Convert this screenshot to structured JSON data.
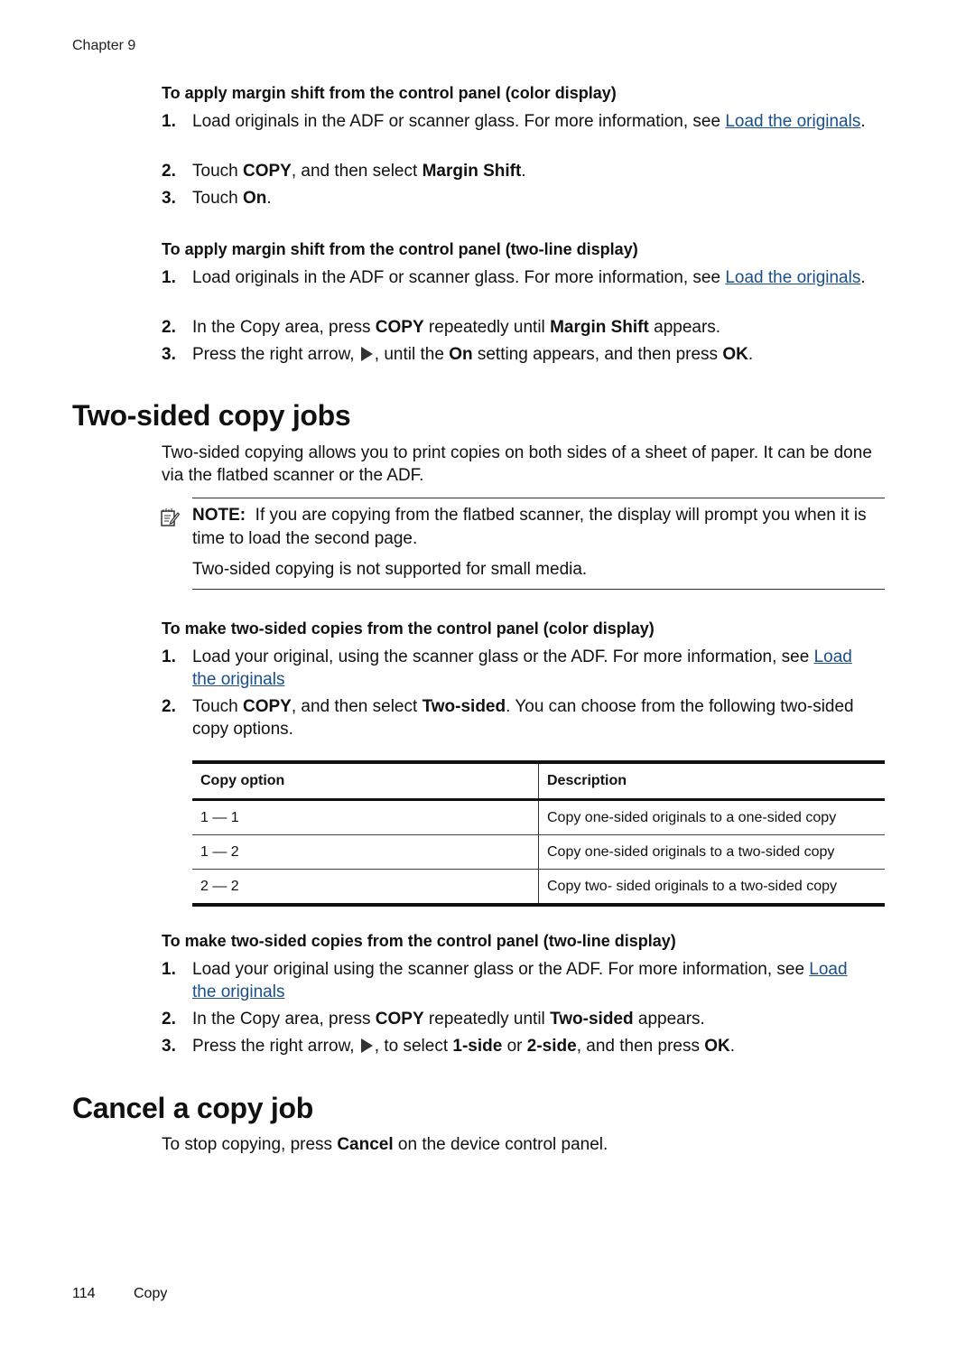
{
  "header": {
    "chapter": "Chapter 9"
  },
  "section_margin": {
    "proc_color": {
      "title": "To apply margin shift from the control panel (color display)",
      "steps": [
        {
          "num": "1.",
          "pre": "Load originals in the ADF or scanner glass. For more information, see ",
          "link": "Load the originals",
          "post": "."
        },
        {
          "num": "2.",
          "a": "Touch ",
          "b1": "COPY",
          "c": ", and then select ",
          "b2": "Margin Shift",
          "d": "."
        },
        {
          "num": "3.",
          "a": "Touch ",
          "b1": "On",
          "c": "."
        }
      ]
    },
    "proc_twoline": {
      "title": "To apply margin shift from the control panel (two-line display)",
      "steps": [
        {
          "num": "1.",
          "pre": "Load originals in the ADF or scanner glass. For more information, see ",
          "link": "Load the originals",
          "post": "."
        },
        {
          "num": "2.",
          "a": "In the Copy area, press ",
          "b1": "COPY",
          "c": " repeatedly until ",
          "b2": "Margin Shift",
          "d": " appears."
        },
        {
          "num": "3.",
          "a": "Press the right arrow, ",
          "icon": "right-arrow-icon",
          "c": ", until the ",
          "b1": "On",
          "d": " setting appears, and then press ",
          "b2": "OK",
          "e": "."
        }
      ]
    }
  },
  "section_twosided": {
    "heading": "Two-sided copy jobs",
    "intro": "Two-sided copying allows you to print copies on both sides of a sheet of paper. It can be done via the flatbed scanner or the ADF.",
    "note": {
      "icon": "note-pencil-icon",
      "label": "NOTE:",
      "text": "If you are copying from the flatbed scanner, the display will prompt you when it is time to load the second page.",
      "text2": "Two-sided copying is not supported for small media."
    },
    "proc_color": {
      "title": "To make two-sided copies from the control panel (color display)",
      "steps": [
        {
          "num": "1.",
          "pre": "Load your original, using the scanner glass or the ADF. For more information, see ",
          "link": "Load the originals"
        },
        {
          "num": "2.",
          "a": "Touch ",
          "b1": "COPY",
          "c": ", and then select ",
          "b2": "Two-sided",
          "d": ". You can choose from the following two-sided copy options."
        }
      ]
    },
    "table": {
      "headers": [
        "Copy option",
        "Description"
      ],
      "rows": [
        [
          "1 — 1",
          "Copy one-sided originals to a one-sided copy"
        ],
        [
          "1 — 2",
          "Copy one-sided originals to a two-sided copy"
        ],
        [
          "2 — 2",
          "Copy two- sided originals to a two-sided copy"
        ]
      ]
    },
    "proc_twoline": {
      "title": "To make two-sided copies from the control panel (two-line display)",
      "steps": [
        {
          "num": "1.",
          "pre": "Load your original using the scanner glass or the ADF. For more information, see ",
          "link": "Load the originals"
        },
        {
          "num": "2.",
          "a": "In the Copy area, press ",
          "b1": "COPY",
          "c": " repeatedly until ",
          "b2": "Two-sided",
          "d": " appears."
        },
        {
          "num": "3.",
          "a": "Press the right arrow, ",
          "icon": "right-arrow-icon",
          "c": ", to select ",
          "b1": "1-side",
          "d": " or ",
          "b2": "2-side",
          "e": ", and then press ",
          "b3": "OK",
          "f": "."
        }
      ]
    }
  },
  "section_cancel": {
    "heading": "Cancel a copy job",
    "a": "To stop copying, press ",
    "b": "Cancel",
    "c": " on the device control panel."
  },
  "footer": {
    "page_number": "114",
    "section": "Copy"
  },
  "colors": {
    "link": "#1a4f8b",
    "text": "#111111"
  }
}
